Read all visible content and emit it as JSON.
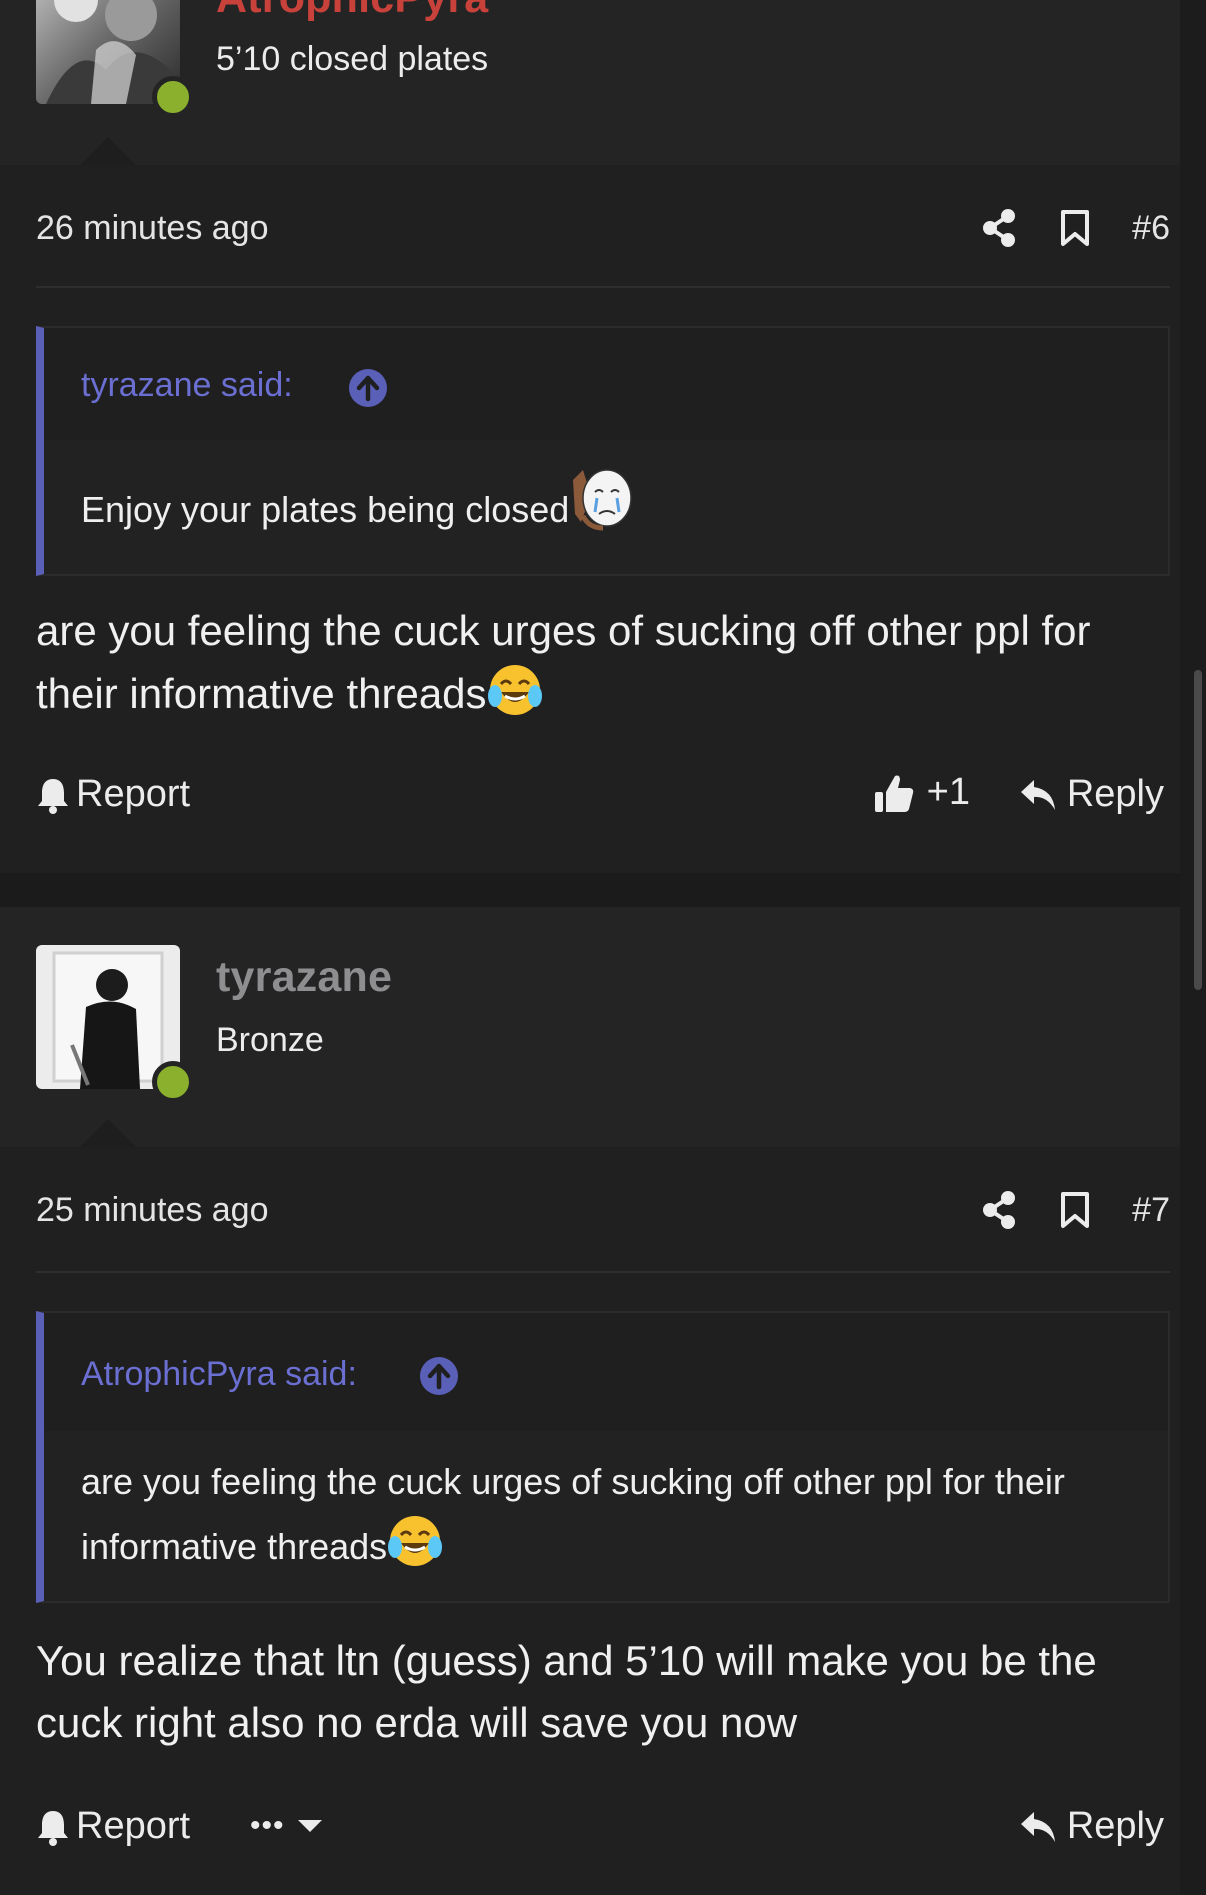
{
  "posts": [
    {
      "username": "AtrophicPyra",
      "username_color": "#c8423b",
      "user_title": "5’10 closed plates",
      "time": "26 minutes ago",
      "post_number": "#6",
      "quote_author": "tyrazane said:",
      "quote_text": "Enjoy your plates being closed",
      "quote_emoji": "crying-wojak-emoji",
      "body": "are you feeling the cuck urges of sucking off other ppl for their informative threads",
      "body_emoji": "laughing-crying-emoji",
      "report_label": "Report",
      "like_label": "+1",
      "reply_label": "Reply"
    },
    {
      "username": "tyrazane",
      "username_color": "#8e8e90",
      "user_title": "Bronze",
      "time": "25 minutes ago",
      "post_number": "#7",
      "quote_author": "AtrophicPyra said:",
      "quote_text": "are you feeling the cuck urges of sucking off other ppl for their informative threads",
      "quote_emoji": "laughing-crying-emoji",
      "body": "You realize that ltn (guess) and 5’10 will make you be the cuck right also no erda will save you now",
      "report_label": "Report",
      "more_label": "•••",
      "reply_label": "Reply"
    }
  ],
  "colors": {
    "accent": "#5a5fb8",
    "online": "#8ab02d",
    "background": "#1c1c1d"
  }
}
